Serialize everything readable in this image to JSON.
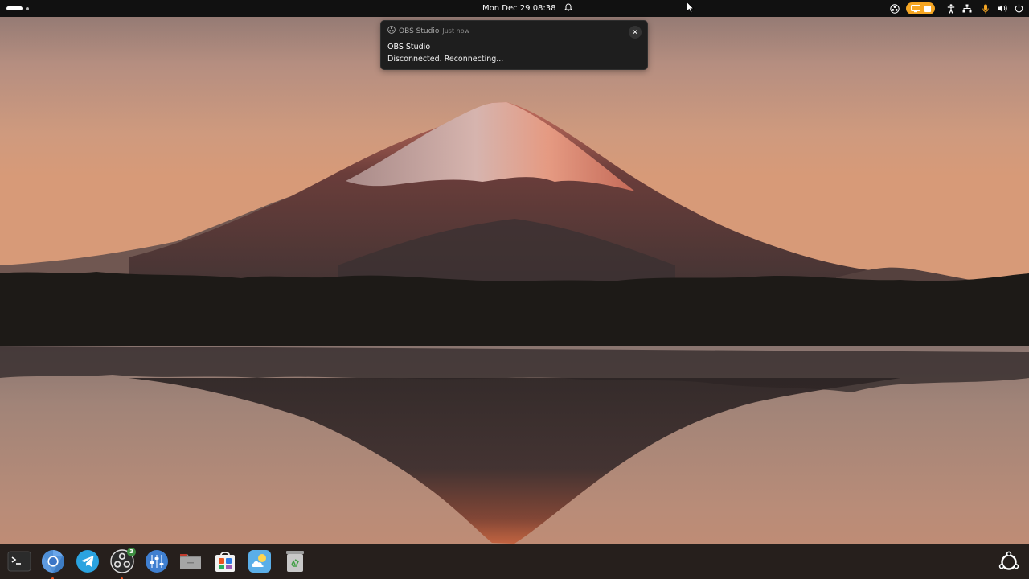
{
  "topbar": {
    "activities_icon": "activities-indicator",
    "clock_text": "Mon Dec 29  08:38",
    "clock_icon": "bell-icon",
    "tray_icons": [
      "obs-tray-icon",
      "screencast-indicator",
      "accessibility-icon",
      "network-icon",
      "microphone-icon",
      "volume-icon",
      "power-icon"
    ],
    "screencast_color": "#f5a623"
  },
  "notification": {
    "app_icon": "obs-icon",
    "app_name": "OBS Studio",
    "time": "Just now",
    "title": "OBS Studio",
    "body": "Disconnected. Reconnecting...",
    "close_icon": "close-icon"
  },
  "dock": {
    "items": [
      {
        "name": "terminal",
        "icon": "terminal-icon",
        "running": false
      },
      {
        "name": "chromium",
        "icon": "chromium-icon",
        "running": true
      },
      {
        "name": "telegram",
        "icon": "telegram-icon",
        "running": false
      },
      {
        "name": "obs-studio",
        "icon": "obs-icon",
        "running": true,
        "badge": "3"
      },
      {
        "name": "mixer",
        "icon": "mixer-icon",
        "running": false
      },
      {
        "name": "files",
        "icon": "folder-icon",
        "running": false
      },
      {
        "name": "app-center",
        "icon": "store-icon",
        "running": false
      },
      {
        "name": "weather",
        "icon": "weather-icon",
        "running": false
      },
      {
        "name": "trash",
        "icon": "trash-icon",
        "running": false
      }
    ],
    "show_apps_icon": "ubuntu-apps-icon",
    "running_dot_color": "#e95420",
    "accent_color": "#e95420"
  },
  "wallpaper": {
    "subject": "mountain-lake-sunset"
  }
}
